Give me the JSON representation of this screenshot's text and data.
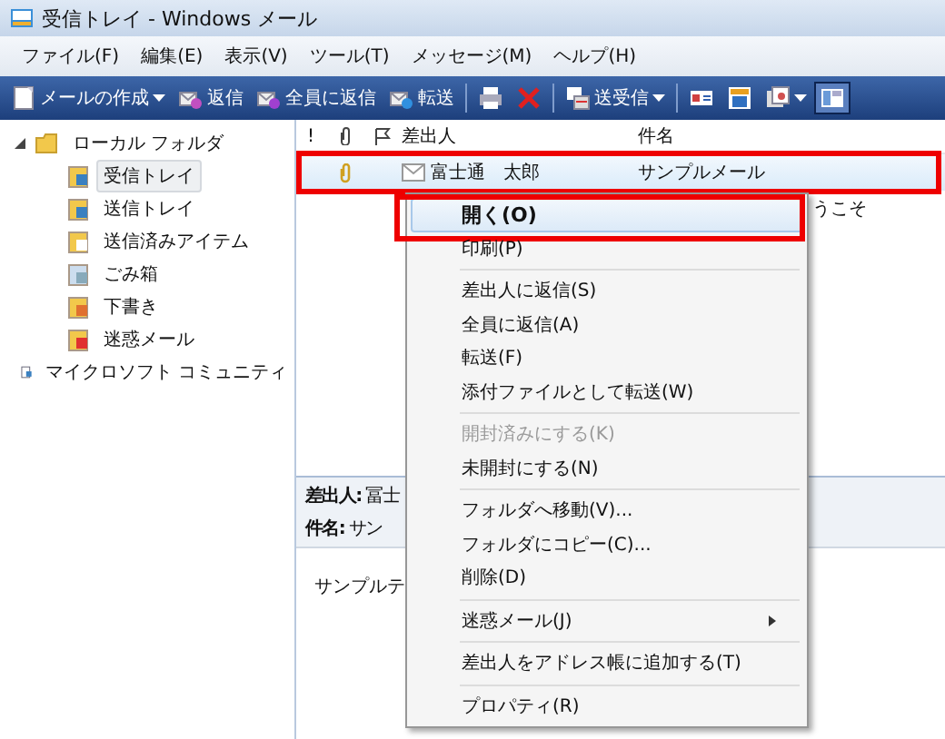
{
  "window": {
    "title": "受信トレイ - Windows メール"
  },
  "menubar": [
    "ファイル(F)",
    "編集(E)",
    "表示(V)",
    "ツール(T)",
    "メッセージ(M)",
    "ヘルプ(H)"
  ],
  "toolbar": [
    {
      "kind": "button",
      "label": "メールの作成",
      "dropdown": true,
      "selected": false
    },
    {
      "kind": "button",
      "label": "返信",
      "selected": false
    },
    {
      "kind": "button",
      "label": "全員に返信",
      "selected": false
    },
    {
      "kind": "button",
      "label": "転送",
      "selected": false
    },
    {
      "kind": "separator"
    },
    {
      "kind": "button",
      "selected": false
    },
    {
      "kind": "button",
      "selected": false
    },
    {
      "kind": "separator"
    },
    {
      "kind": "button",
      "label": "送受信",
      "dropdown": true,
      "selected": false
    },
    {
      "kind": "separator"
    },
    {
      "kind": "button",
      "selected": false
    },
    {
      "kind": "button",
      "selected": false
    },
    {
      "kind": "button",
      "dropdown": true,
      "selected": false
    },
    {
      "kind": "button",
      "selected": true
    }
  ],
  "tree": [
    {
      "label": "ローカル フォルダ",
      "expanded": true,
      "selected": false,
      "children": [
        {
          "label": "受信トレイ",
          "selected": true
        },
        {
          "label": "送信トレイ",
          "selected": false
        },
        {
          "label": "送信済みアイテム",
          "selected": false
        },
        {
          "label": "ごみ箱",
          "selected": false
        },
        {
          "label": "下書き",
          "selected": false
        },
        {
          "label": "迷惑メール",
          "selected": false
        }
      ]
    },
    {
      "label": "マイクロソフト コミュニティ",
      "selected": false
    }
  ],
  "message_list": {
    "columns": [
      "!",
      "差出人",
      "件名"
    ],
    "rows": [
      {
        "attachment": true,
        "sender": "富士通　太郎",
        "subject": "サンプルメール",
        "selected": true,
        "highlighted": true
      },
      {
        "subject": "うこそ",
        "selected": false
      }
    ]
  },
  "preview": {
    "from": "**差出人:** 冨士",
    "subject": "**件名:** サン",
    "body": "サンプルテ"
  },
  "context_menu": [
    {
      "kind": "item",
      "label": "開く(O)",
      "bold": true,
      "selected": true,
      "highlighted": true
    },
    {
      "kind": "item",
      "label": "印刷(P)",
      "selected": false
    },
    {
      "kind": "separator"
    },
    {
      "kind": "item",
      "label": "差出人に返信(S)",
      "selected": false
    },
    {
      "kind": "item",
      "label": "全員に返信(A)",
      "selected": false
    },
    {
      "kind": "item",
      "label": "転送(F)",
      "selected": false
    },
    {
      "kind": "item",
      "label": "添付ファイルとして転送(W)",
      "selected": false
    },
    {
      "kind": "separator"
    },
    {
      "kind": "item",
      "label": "開封済みにする(K)",
      "selected": false,
      "disabled": true
    },
    {
      "kind": "item",
      "label": "未開封にする(N)",
      "selected": false
    },
    {
      "kind": "separator"
    },
    {
      "kind": "item",
      "label": "フォルダへ移動(V)...",
      "selected": false
    },
    {
      "kind": "item",
      "label": "フォルダにコピー(C)...",
      "selected": false
    },
    {
      "kind": "item",
      "label": "削除(D)",
      "selected": false
    },
    {
      "kind": "separator"
    },
    {
      "kind": "item",
      "label": "迷惑メール(J)",
      "selected": false,
      "submenu": true
    },
    {
      "kind": "separator"
    },
    {
      "kind": "item",
      "label": "差出人をアドレス帳に追加する(T)",
      "selected": false
    },
    {
      "kind": "separator"
    },
    {
      "kind": "item",
      "label": "プロパティ(R)",
      "selected": false
    }
  ]
}
